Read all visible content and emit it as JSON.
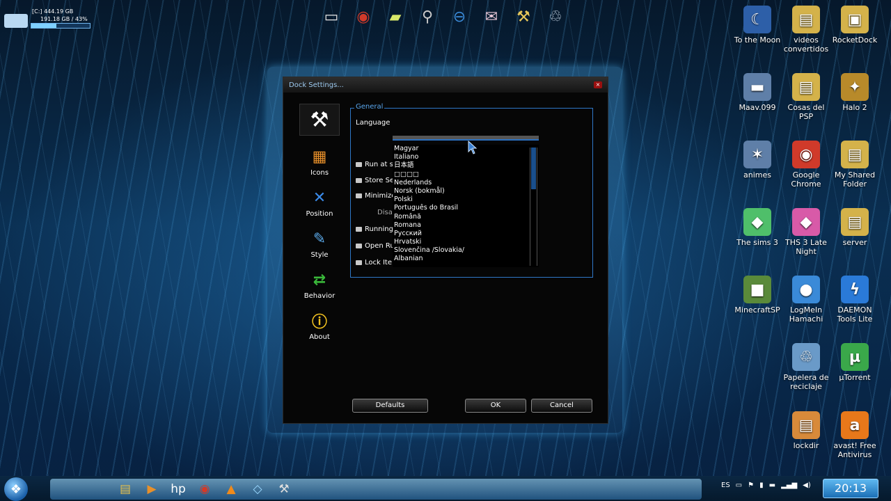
{
  "drive": {
    "label_1": "[C:] 444.19 GB",
    "label_2": "191.18 GB / 43%",
    "used_fraction": 0.43
  },
  "top_dock": {
    "items": [
      "computer-icon",
      "chrome-icon",
      "notes-icon",
      "tools-icon",
      "network-icon",
      "pictures-icon",
      "settings-icon",
      "recycle-bin-icon"
    ]
  },
  "desktop_icons": [
    {
      "label": "To the Moon",
      "glyph": "☾",
      "color": "#2d5fa8"
    },
    {
      "label": "videos convertidos",
      "glyph": "▤",
      "color": "#d4b24a"
    },
    {
      "label": "RocketDock",
      "glyph": "▣",
      "color": "#d4b24a"
    },
    {
      "label": "Maav.099",
      "glyph": "▬",
      "color": "#5f7fa8"
    },
    {
      "label": "Cosas del PSP",
      "glyph": "▤",
      "color": "#d4b24a"
    },
    {
      "label": "Halo 2",
      "glyph": "✦",
      "color": "#b88a2a"
    },
    {
      "label": "animes",
      "glyph": "✶",
      "color": "#5f7fa8"
    },
    {
      "label": "Google Chrome",
      "glyph": "◉",
      "color": "#d03a2a"
    },
    {
      "label": "My Shared Folder",
      "glyph": "▤",
      "color": "#d4b24a"
    },
    {
      "label": "The sims 3",
      "glyph": "◆",
      "color": "#4fbf6a"
    },
    {
      "label": "THS 3 Late Night",
      "glyph": "◆",
      "color": "#d85aa8"
    },
    {
      "label": "server",
      "glyph": "▤",
      "color": "#d4b24a"
    },
    {
      "label": "MinecraftSP",
      "glyph": "■",
      "color": "#5a8a3a"
    },
    {
      "label": "LogMeIn Hamachi",
      "glyph": "●",
      "color": "#3a8ad8"
    },
    {
      "label": "DAEMON Tools Lite",
      "glyph": "ϟ",
      "color": "#2a7ad8"
    },
    {
      "label": "Papelera de reciclaje",
      "glyph": "♲",
      "color": "#6a9ac8"
    },
    {
      "label": "µTorrent",
      "glyph": "µ",
      "color": "#3aa84a"
    },
    {
      "label": "lockdir",
      "glyph": "▤",
      "color": "#d88a3a"
    },
    {
      "label": "avast! Free Antivirus",
      "glyph": "a",
      "color": "#e8781a"
    }
  ],
  "dialog": {
    "title": "Dock Settings...",
    "close": "×",
    "nav": [
      {
        "label": "",
        "glyph": "⚒"
      },
      {
        "label": "Icons",
        "glyph": "▦"
      },
      {
        "label": "Position",
        "glyph": "✕"
      },
      {
        "label": "Style",
        "glyph": "✎"
      },
      {
        "label": "Behavior",
        "glyph": "⇄"
      },
      {
        "label": "About",
        "glyph": "ⓘ"
      }
    ],
    "group_title": "General",
    "language_label": "Language",
    "options": [
      "Run at s",
      "Store Se",
      "Minimize",
      "Disat",
      "Running",
      "Open Ru",
      "Lock Ite"
    ],
    "languages": [
      "Magyar",
      "Italiano",
      "日本語",
      "□□□□",
      "Nederlands",
      "Norsk (bokmål)",
      "Polski",
      "Português do Brasil",
      "Română",
      "Romana",
      "Русский",
      "Hrvatski",
      "Slovenčina /Slovakia/",
      "Albanian"
    ],
    "buttons": {
      "defaults": "Defaults",
      "ok": "OK",
      "cancel": "Cancel"
    }
  },
  "taskbar": {
    "start_glyph": "❖",
    "icons": [
      {
        "name": "explorer-icon",
        "glyph": "▤"
      },
      {
        "name": "media-player-icon",
        "glyph": "▶"
      },
      {
        "name": "hp-icon",
        "glyph": "hp"
      },
      {
        "name": "chrome-icon",
        "glyph": "◉"
      },
      {
        "name": "vlc-icon",
        "glyph": "▲"
      },
      {
        "name": "app-icon",
        "glyph": "◇"
      },
      {
        "name": "tools-icon",
        "glyph": "⚒"
      }
    ],
    "lang": "ES",
    "time": "20:13"
  }
}
